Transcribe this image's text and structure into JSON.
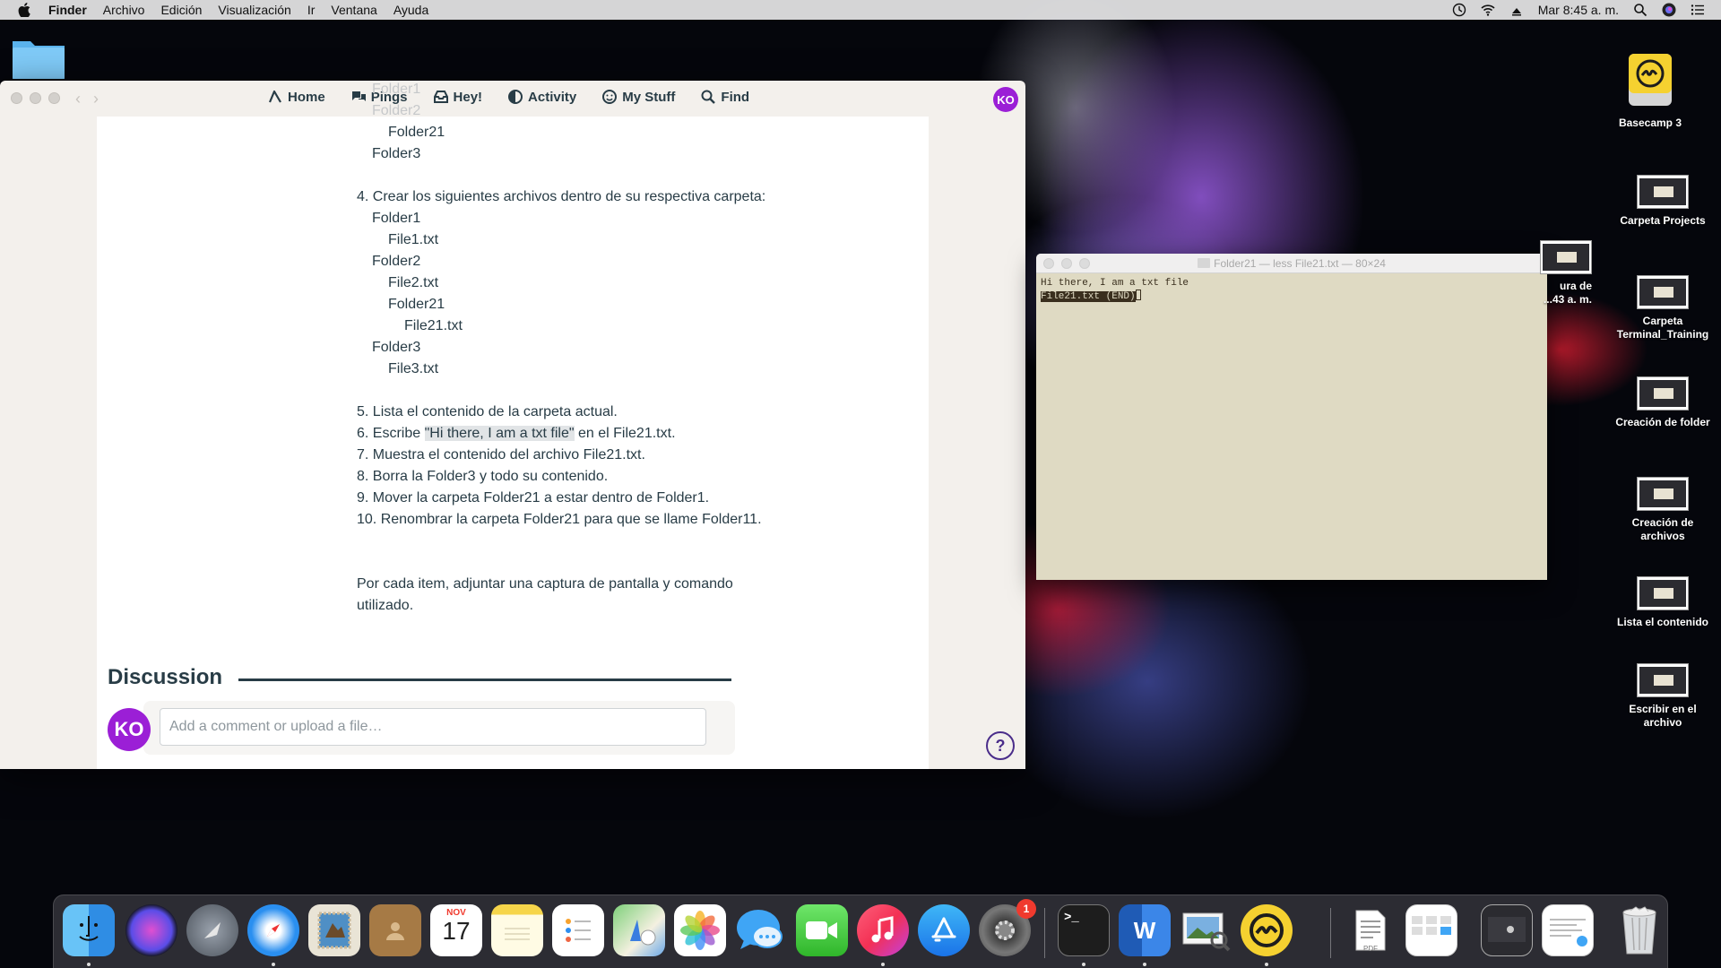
{
  "menubar": {
    "app_name": "Finder",
    "items": [
      "Archivo",
      "Edición",
      "Visualización",
      "Ir",
      "Ventana",
      "Ayuda"
    ],
    "clock": "Mar 8:45 a. m."
  },
  "browser": {
    "nav": {
      "home": "Home",
      "pings": "Pings",
      "hey": "Hey!",
      "activity": "Activity",
      "mystuff": "My Stuff",
      "find": "Find"
    },
    "user_initials": "KO",
    "doc_lines": [
      "Folder1",
      "Folder2",
      "Folder21",
      "Folder3",
      "",
      "4. Crear los siguientes archivos dentro de su respectiva carpeta:",
      "Folder1",
      "File1.txt",
      "Folder2",
      "File2.txt",
      "Folder21",
      "File21.txt",
      "Folder3",
      "File3.txt",
      "",
      "5. Lista el contenido de la carpeta actual.",
      "6. Escribe ",
      "\"Hi there, I am a txt file\"",
      " en el File21.txt.",
      "7. Muestra el contenido del archivo File21.txt.",
      "8. Borra la Folder3 y todo su contenido.",
      "9. Mover la carpeta Folder21 a estar dentro de Folder1.",
      "10. Renombrar la carpeta Folder21 para que se llame Folder11.",
      "",
      "",
      "Por cada item, adjuntar una captura de pantalla y comando",
      "utilizado."
    ],
    "discussion_title": "Discussion",
    "comment_placeholder": "Add a comment or upload a file…",
    "help": "?"
  },
  "terminal": {
    "title": "Folder21 — less File21.txt — 80×24",
    "line1": "Hi there, I am a txt file",
    "line2": "File21.txt (END)"
  },
  "desktop_icons": [
    "Basecamp 3",
    "Carpeta Projects",
    "ura de",
    "...43 a. m.",
    "Carpeta Terminal_Training",
    "Creación de folder",
    "Creación de archivos",
    "Lista el contenido",
    "Escribir en el archivo"
  ],
  "dock": {
    "calendar_month": "NOV",
    "calendar_day": "17",
    "sysprefs_badge": "1",
    "word_letter": "W",
    "terminal_prompt": ">_",
    "pdf_label": "PDF"
  }
}
